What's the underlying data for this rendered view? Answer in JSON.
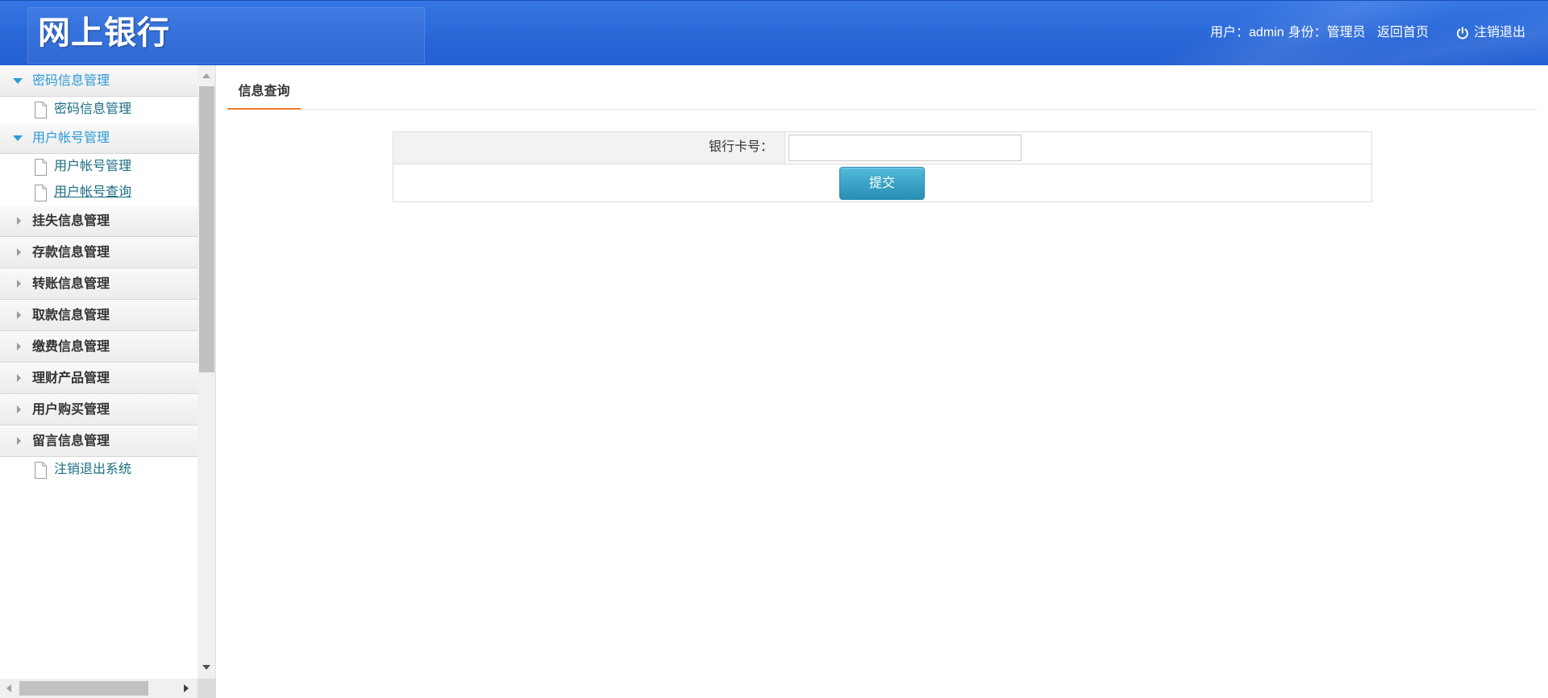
{
  "header": {
    "title": "网上银行",
    "user_label": "用户：",
    "username": "admin",
    "role_label": "身份：",
    "role": "管理员",
    "home_link": "返回首页",
    "logout_link": "注销退出",
    "logout_icon": "power-icon"
  },
  "sidebar": {
    "item_icon": "document-icon",
    "groups": [
      {
        "label": "密码信息管理",
        "expanded": true,
        "children": [
          {
            "label": "密码信息管理"
          }
        ]
      },
      {
        "label": "用户帐号管理",
        "expanded": true,
        "children": [
          {
            "label": "用户帐号管理"
          },
          {
            "label": "用户帐号查询",
            "active": true
          }
        ]
      },
      {
        "label": "挂失信息管理",
        "expanded": false
      },
      {
        "label": "存款信息管理",
        "expanded": false
      },
      {
        "label": "转账信息管理",
        "expanded": false
      },
      {
        "label": "取款信息管理",
        "expanded": false
      },
      {
        "label": "缴费信息管理",
        "expanded": false
      },
      {
        "label": "理财产品管理",
        "expanded": false
      },
      {
        "label": "用户购买管理",
        "expanded": false
      },
      {
        "label": "留言信息管理",
        "expanded": false
      }
    ],
    "logout_item": {
      "label": "注销退出系统"
    }
  },
  "main": {
    "tabs": [
      {
        "label": "信息查询",
        "active": true
      }
    ],
    "form": {
      "fields": [
        {
          "label": "银行卡号：",
          "value": ""
        }
      ],
      "submit_label": "提交"
    }
  },
  "colors": {
    "header_bg": "#2a68d8",
    "accent": "#2e9ad6",
    "link": "#1b6d80",
    "tab_underline": "#f07a2a",
    "button": "#3aa3c6"
  }
}
